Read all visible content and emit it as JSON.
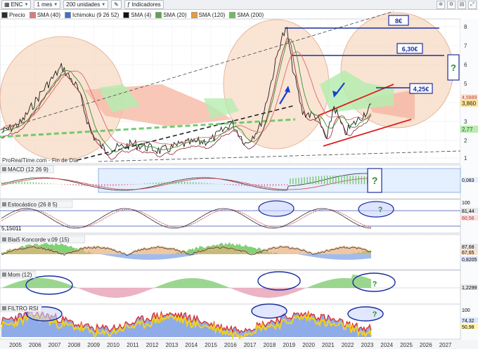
{
  "toolbar": {
    "symbol": "ENC",
    "period": "1 mes",
    "units": "200 unidades",
    "indicators": "Indicadores"
  },
  "legend": [
    {
      "label": "Precio",
      "color": "#2b2b2b"
    },
    {
      "label": "SMA (40)",
      "color": "#e07a7a"
    },
    {
      "label": "Ichimoku (9 26 52)",
      "color": "#3b6fd1"
    },
    {
      "label": "SMA (4)",
      "color": "#111111"
    },
    {
      "label": "SMA (20)",
      "color": "#5aa84a"
    },
    {
      "label": "SMA (120)",
      "color": "#e89a3c"
    },
    {
      "label": "SMA (200)",
      "color": "#6bbf5a"
    }
  ],
  "main": {
    "source": "ProRealTime.com - Fin de Día",
    "y_ticks": [
      "8",
      "7",
      "6",
      "5",
      "4",
      "3",
      "2",
      "1"
    ],
    "price_labels": {
      "p1": "4,5889",
      "p2": "3,860",
      "p3": "2,77"
    },
    "targets": [
      {
        "label": "8€"
      },
      {
        "label": "6,30€"
      },
      {
        "label": "4,25€"
      }
    ],
    "question": "?"
  },
  "panels": [
    {
      "title": "MACD (12 26 9)",
      "value": "0,083",
      "question": "?"
    },
    {
      "title": "Estocástico (26 8 5)",
      "left_value": "5,15011",
      "v1": "81,44",
      "v2": "60,56",
      "tick": "100",
      "question": "?"
    },
    {
      "title": "Blai5 Koncorde v.09 (15)",
      "v1": "87,68",
      "v2": "67,65",
      "v3": "0,8205",
      "question": ""
    },
    {
      "title": "Mom (12)",
      "v1": "1,2299",
      "question": "?"
    },
    {
      "title": "FILTRO RSI",
      "v1": "74,32",
      "v2": "50,98",
      "tick": "100",
      "question": "?"
    }
  ],
  "x_axis": [
    "2005",
    "2006",
    "2007",
    "2008",
    "2009",
    "2010",
    "2011",
    "2012",
    "2013",
    "2014",
    "2015",
    "2016",
    "2017",
    "2018",
    "2019",
    "2020",
    "2021",
    "2022",
    "2023",
    "2024",
    "2025",
    "2026",
    "2027"
  ],
  "colors": {
    "accent": "#1a2fa0",
    "target": "#2233aa",
    "channel": "#e02020",
    "circle": "#f3c9a8",
    "cloud_green": "#a8e6a0",
    "cloud_red": "#f5b8a8"
  }
}
